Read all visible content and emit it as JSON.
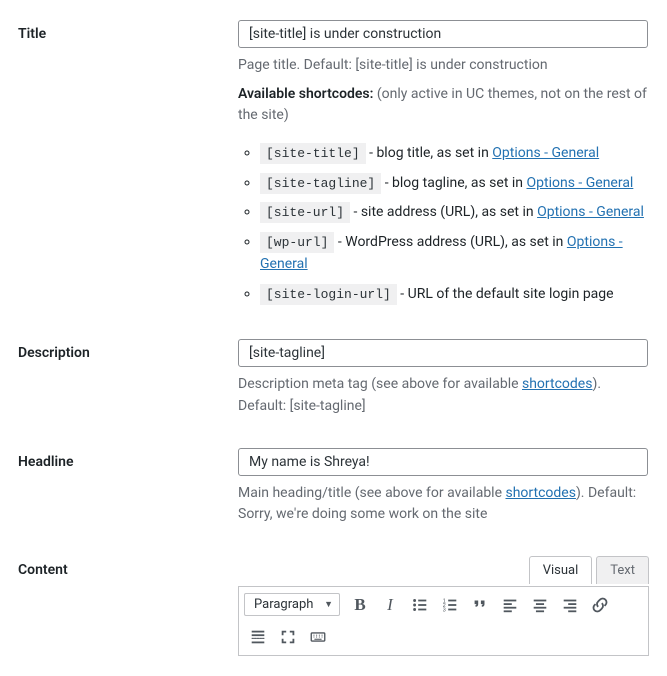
{
  "title": {
    "label": "Title",
    "value": "[site-title] is under construction",
    "help_default": "Page title. Default: [site-title] is under construction",
    "available_prefix": "Available shortcodes:",
    "available_suffix_a": " (only active in UC themes, not on the rest of the site)",
    "sc": [
      {
        "code": "[site-title]",
        "desc": " - blog title, as set in ",
        "link": "Options - General"
      },
      {
        "code": "[site-tagline]",
        "desc": " - blog tagline, as set in ",
        "link": "Options - General"
      },
      {
        "code": "[site-url]",
        "desc": " - site address (URL), as set in ",
        "link": "Options - General"
      },
      {
        "code": "[wp-url]",
        "desc": " - WordPress address (URL), as set in ",
        "link": "Options - General"
      },
      {
        "code": "[site-login-url]",
        "desc": " - URL of the default site login page",
        "link": ""
      }
    ]
  },
  "description": {
    "label": "Description",
    "value": "[site-tagline]",
    "help_a": "Description meta tag (see above for available ",
    "help_link": "shortcodes",
    "help_b": "). Default: [site-tagline]"
  },
  "headline": {
    "label": "Headline",
    "value": "My name is Shreya!",
    "help_a": "Main heading/title (see above for available ",
    "help_link": "shortcodes",
    "help_b": "). Default: Sorry, we're doing some work on the site"
  },
  "content": {
    "label": "Content",
    "tabs": {
      "visual": "Visual",
      "text": "Text"
    },
    "format": "Paragraph"
  }
}
